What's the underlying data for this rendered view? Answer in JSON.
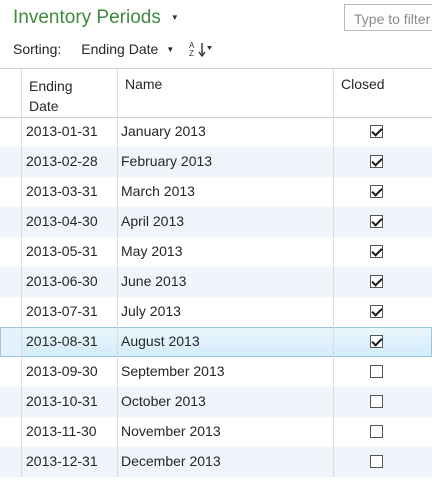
{
  "header": {
    "title": "Inventory Periods",
    "search_placeholder": "Type to filter"
  },
  "sortbar": {
    "label": "Sorting:",
    "field": "Ending Date",
    "direction_icon": "sort-ascending-icon"
  },
  "columns": {
    "ending_date": "Ending\nDate",
    "name": "Name",
    "closed": "Closed"
  },
  "rows": [
    {
      "date": "2013-01-31",
      "name": "January 2013",
      "closed": true
    },
    {
      "date": "2013-02-28",
      "name": "February 2013",
      "closed": true
    },
    {
      "date": "2013-03-31",
      "name": "March 2013",
      "closed": true
    },
    {
      "date": "2013-04-30",
      "name": "April 2013",
      "closed": true
    },
    {
      "date": "2013-05-31",
      "name": "May 2013",
      "closed": true
    },
    {
      "date": "2013-06-30",
      "name": "June 2013",
      "closed": true
    },
    {
      "date": "2013-07-31",
      "name": "July 2013",
      "closed": true
    },
    {
      "date": "2013-08-31",
      "name": "August 2013",
      "closed": true,
      "selected": true
    },
    {
      "date": "2013-09-30",
      "name": "September 2013",
      "closed": false
    },
    {
      "date": "2013-10-31",
      "name": "October 2013",
      "closed": false
    },
    {
      "date": "2013-11-30",
      "name": "November 2013",
      "closed": false
    },
    {
      "date": "2013-12-31",
      "name": "December 2013",
      "closed": false
    }
  ],
  "colors": {
    "title": "#3f8a3f",
    "alt_row": "#f0f5fc",
    "selected_row": "#d3ecfb"
  }
}
